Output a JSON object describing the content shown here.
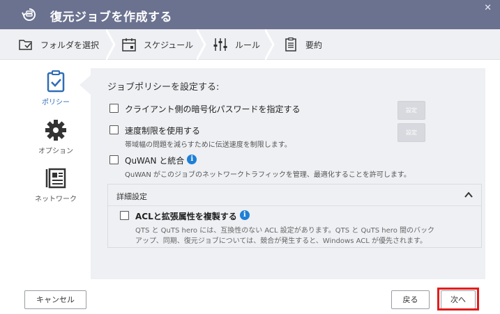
{
  "header": {
    "title": "復元ジョブを作成する",
    "close_icon": "close-icon",
    "logo_icon": "restore-job-icon"
  },
  "steps": [
    {
      "label": "フォルダを選択",
      "icon": "folder-select-icon"
    },
    {
      "label": "スケジュール",
      "icon": "calendar-icon"
    },
    {
      "label": "ルール",
      "icon": "sliders-icon"
    },
    {
      "label": "要約",
      "icon": "summary-clipboard-icon"
    }
  ],
  "nav": [
    {
      "label": "ポリシー",
      "icon": "policy-clipboard-icon",
      "active": true
    },
    {
      "label": "オプション",
      "icon": "gear-icon",
      "active": false
    },
    {
      "label": "ネットワーク",
      "icon": "network-icon",
      "active": false
    }
  ],
  "panel": {
    "title": "ジョブポリシーを設定する:",
    "options": [
      {
        "label": "クライアント側の暗号化パスワードを指定する",
        "checked": false,
        "button": "設定"
      },
      {
        "label": "速度制限を使用する",
        "desc": "帯域幅の問題を減らすために伝送速度を制限します。",
        "checked": false,
        "button": "設定"
      },
      {
        "label": "QuWAN と統合",
        "desc": "QuWAN がこのジョブのネットワークトラフィックを管理、最適化することを許可します。",
        "checked": false
      }
    ],
    "advanced": {
      "title": "詳細設定",
      "option_label": "ACLと拡張属性を複製する",
      "desc_line1": "QTS と QuTS hero には、互換性のない ACL 設定があります。QTS と QuTS hero 間のバック",
      "desc_line2": "アップ、同期、復元ジョブについては、競合が発生すると、Windows ACL が優先されます。"
    }
  },
  "footer": {
    "cancel": "キャンセル",
    "back": "戻る",
    "next": "次へ"
  },
  "colors": {
    "header_bg": "#6b7290",
    "accent": "#2f6db5",
    "highlight": "#e21d1d",
    "info": "#1e7fd6"
  }
}
